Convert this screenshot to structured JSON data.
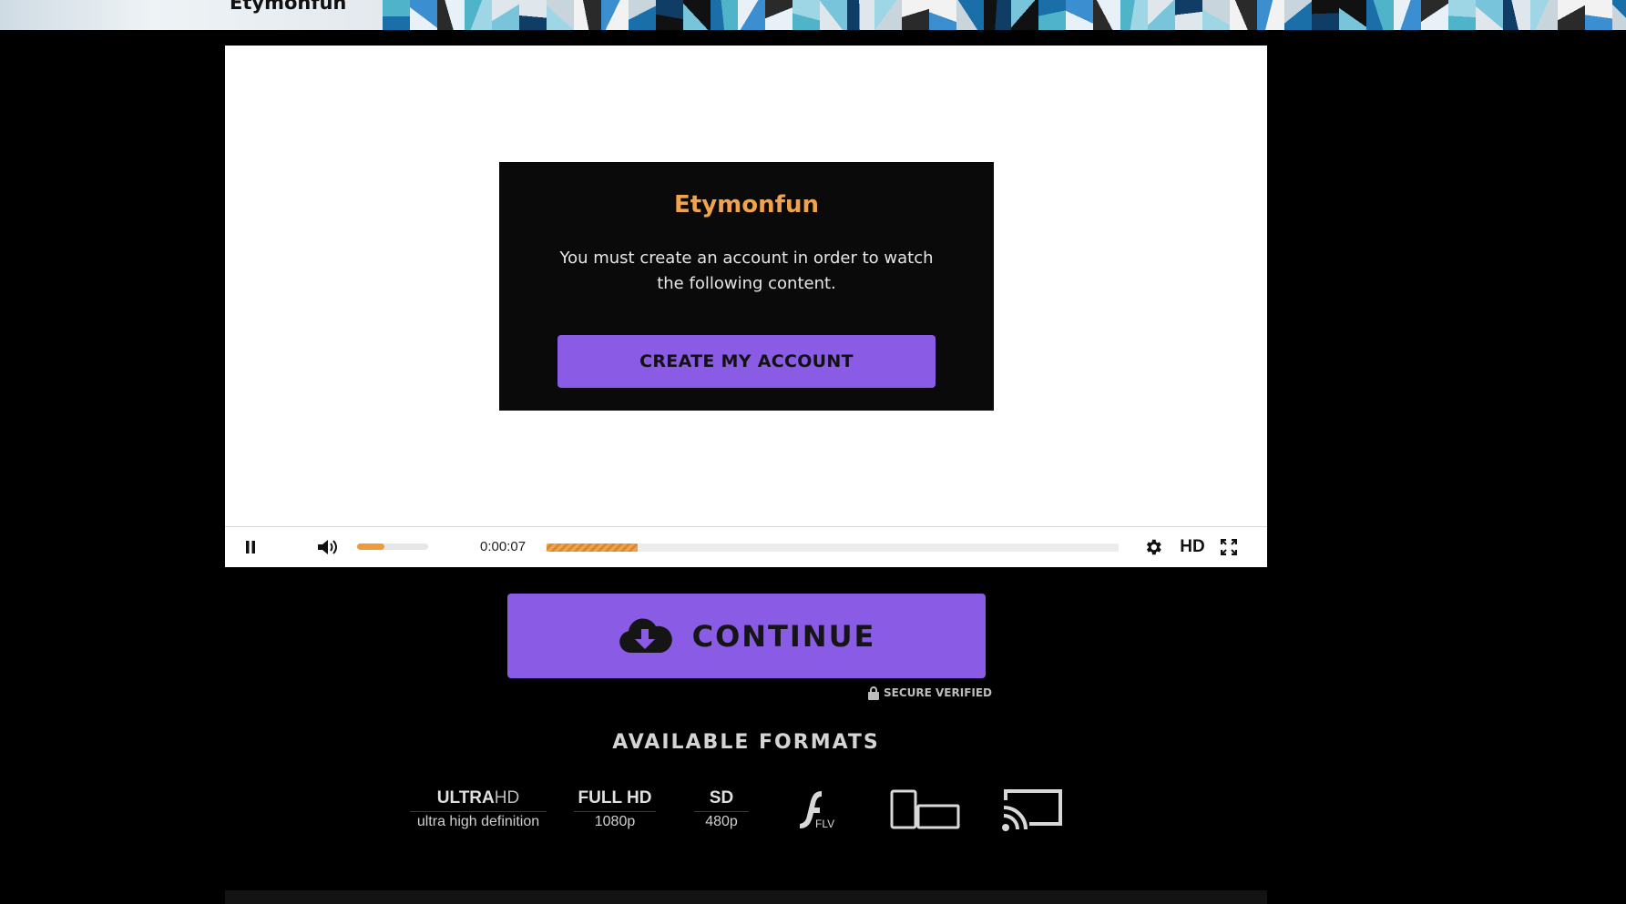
{
  "banner": {
    "title": "Etymonfun"
  },
  "modal": {
    "title": "Etymonfun",
    "message": "You must create an account in order to watch the following content.",
    "button": "CREATE MY ACCOUNT"
  },
  "player": {
    "time": "0:00:07",
    "quality": "HD",
    "volume_fraction": 0.38,
    "progress_fraction": 0.16
  },
  "continue": {
    "label": "CONTINUE"
  },
  "secure": {
    "label": "SECURE VERIFIED"
  },
  "formats": {
    "title": "AVAILABLE FORMATS",
    "ultra": {
      "bold": "ULTRA",
      "light": "HD",
      "sub": "ultra high definition"
    },
    "fullhd": {
      "main": "FULL HD",
      "sub": "1080p"
    },
    "sd": {
      "main": "SD",
      "sub": "480p"
    },
    "flv": {
      "label": "FLV",
      "icon": "flash-icon"
    },
    "devices_icon": "devices-icon",
    "cast_icon": "cast-icon"
  },
  "colors": {
    "accent": "#8a5ce6",
    "orange": "#f0a34a"
  }
}
